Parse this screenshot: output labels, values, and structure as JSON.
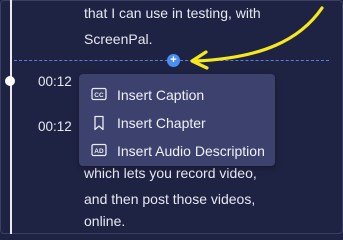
{
  "transcript": {
    "line_above_1": "that I can use in testing, with",
    "line_above_2": "ScreenPal.",
    "timestamp_1": "00:12",
    "timestamp_2": "00:12",
    "line_below_1": "which lets you record video,",
    "line_below_2": "and then post those videos,",
    "line_below_3": "online."
  },
  "insert_button": {
    "label": "+"
  },
  "insert_menu": {
    "items": [
      {
        "label": "Insert Caption",
        "icon": "cc-icon"
      },
      {
        "label": "Insert Chapter",
        "icon": "bookmark-icon"
      },
      {
        "label": "Insert Audio Description",
        "icon": "ad-icon"
      }
    ]
  },
  "colors": {
    "background": "#1f2343",
    "menu_background": "#3c416d",
    "accent_blue": "#4c8ff2",
    "arrow_yellow": "#f5e81d"
  }
}
